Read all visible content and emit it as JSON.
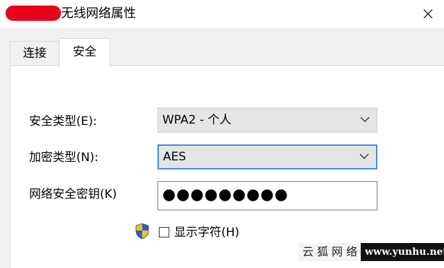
{
  "window": {
    "title": "无线网络属性",
    "close_icon": "close-icon"
  },
  "tabs": [
    {
      "label": "连接",
      "selected": false
    },
    {
      "label": "安全",
      "selected": true
    }
  ],
  "security": {
    "security_type_label": "安全类型(E):",
    "security_type_value": "WPA2 - 个人",
    "encryption_type_label": "加密类型(N):",
    "encryption_type_value": "AES",
    "network_key_label": "网络安全密钥(K)",
    "network_key_value": "●●●●●●●●●",
    "show_characters_label": "显示字符(H)",
    "show_characters_checked": false,
    "shield_icon": "uac-shield-icon"
  },
  "watermark": {
    "site_name": "云狐网络",
    "site_url": "www.yunhu.net"
  },
  "colors": {
    "focus_border": "#3c8fd8",
    "redaction": "#e8001a"
  }
}
